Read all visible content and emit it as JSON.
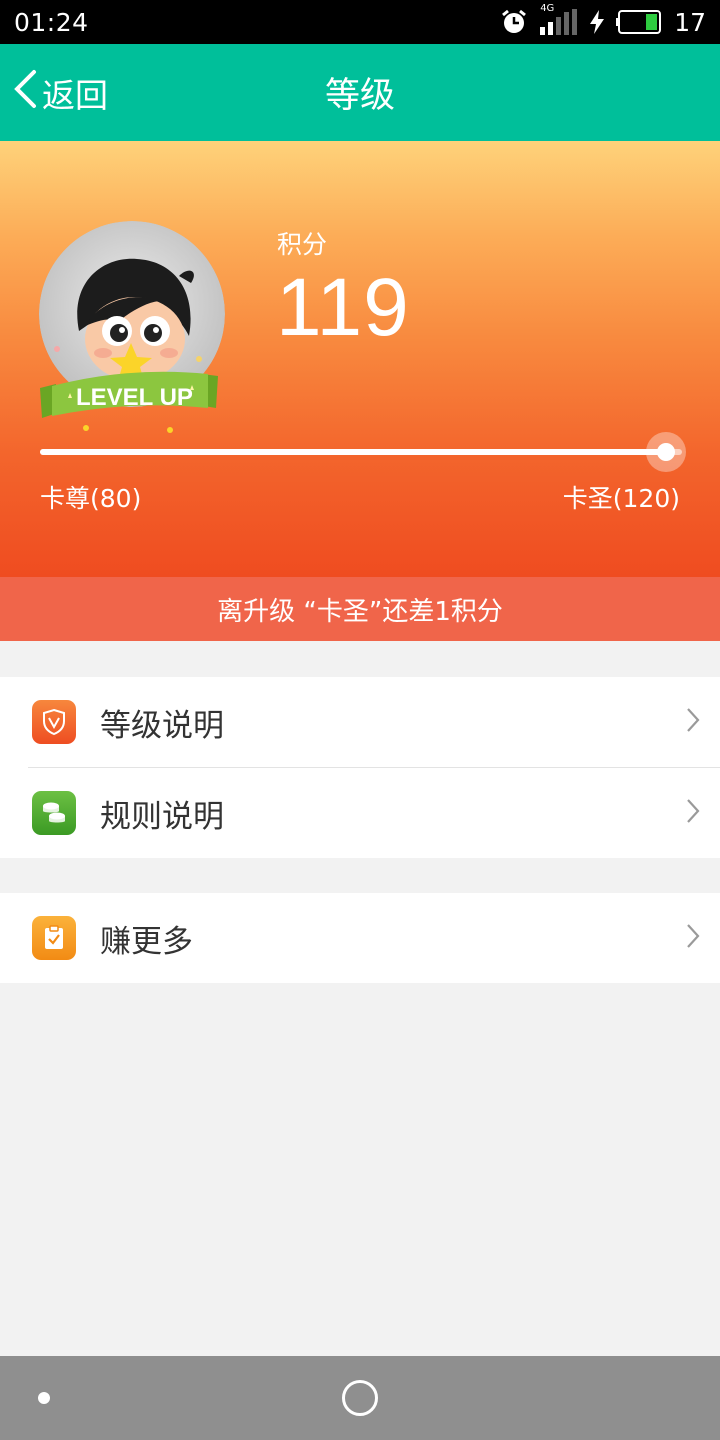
{
  "status_bar": {
    "time": "01:24",
    "network": "4G",
    "battery": "17",
    "icons": [
      "alarm-icon",
      "signal-icon",
      "charging-icon",
      "battery-icon"
    ]
  },
  "app_bar": {
    "back_label": "返回",
    "title": "等级"
  },
  "hero": {
    "points_label": "积分",
    "points_value": "119",
    "badge_text": "LEVEL UP",
    "current_level": "卡尊(80)",
    "next_level": "卡圣(120)",
    "progress_fraction": 0.975
  },
  "notice": {
    "text": "离升级 “卡圣”还差1积分"
  },
  "menu": {
    "group1": [
      {
        "label": "等级说明",
        "icon": "shield-v-icon",
        "icon_color": "#f0592b"
      },
      {
        "label": "规则说明",
        "icon": "coins-icon",
        "icon_color": "#4aa72e"
      }
    ],
    "group2": [
      {
        "label": "赚更多",
        "icon": "clipboard-check-icon",
        "icon_color": "#f6961e"
      }
    ]
  },
  "colors": {
    "app_bar": "#00bf9a",
    "notice": "#f0654a",
    "nav_bar": "#8f8f8f"
  }
}
